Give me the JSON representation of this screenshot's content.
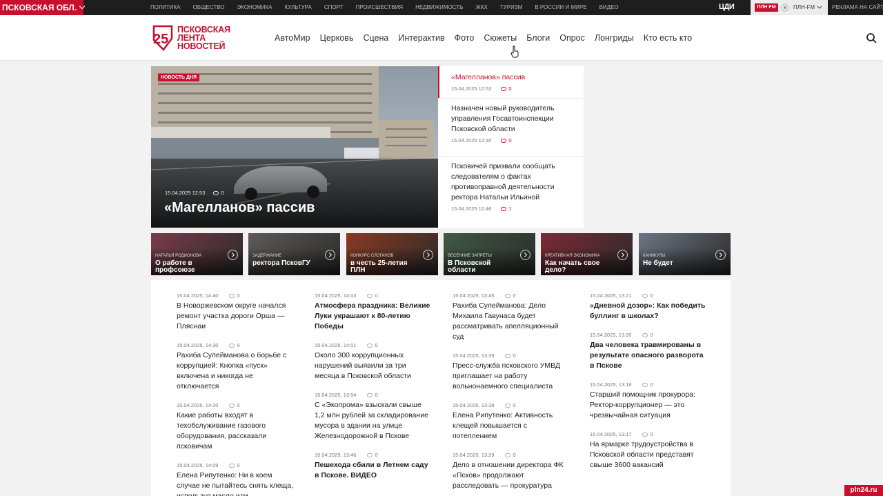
{
  "topbar": {
    "region": "ПСКОВСКАЯ ОБЛ.",
    "categories": [
      "ПОЛИТИКА",
      "ОБЩЕСТВО",
      "ЭКОНОМИКА",
      "КУЛЬТУРА",
      "СПОРТ",
      "ПРОИСШЕСТВИЯ",
      "НЕДВИЖИМОСТЬ",
      "ЖКХ",
      "ТУРИЗМ",
      "В РОССИИ И МИРЕ",
      "ВИДЕО"
    ],
    "cdi_logo": "ЦДИ",
    "radio_badge": "ПЛН FM",
    "radio_name": "ПЛН-FM",
    "advertising": "РЕКЛАМА НА САЙТЕ"
  },
  "header": {
    "logo_lines": [
      "ПСКОВСКАЯ",
      "ЛЕНТА",
      "НОВОСТЕЙ"
    ],
    "logo_number": "25",
    "nav": [
      "АвтоМир",
      "Церковь",
      "Сцена",
      "Интерактив",
      "Фото",
      "Сюжеты",
      "Блоги",
      "Опрос",
      "Лонгриды",
      "Кто есть кто"
    ]
  },
  "hero": {
    "badge": "НОВОСТЬ ДНЯ",
    "date": "15.04.2025 12:53",
    "comments": "0",
    "title": "«Магелланов» пассив"
  },
  "side": [
    {
      "title": "«Магелланов» пассив",
      "date": "15.04.2025 12:53",
      "comments": "0"
    },
    {
      "title": "Назначен новый руководитель управления Госавтоинспекции Псковской области",
      "date": "15.04.2025 12:30",
      "comments": "0"
    },
    {
      "title": "Псковичей призвали сообщать следователям о фактах противоправной деятельности ректора Натальи Ильиной",
      "date": "15.04.2025 12:46",
      "comments": "1"
    }
  ],
  "thumbs": [
    {
      "kicker": "НАТАЛЬЯ РОДИОНОВА",
      "title": "О работе в профсоюзе",
      "color": "#7a3b4a"
    },
    {
      "kicker": "ЗАДЕРЖАНИЕ",
      "title": "ректора ПсковГУ",
      "color": "#5d5a58"
    },
    {
      "kicker": "КОНКУРС СЛОГАНОВ",
      "title": "в честь 25-летия ПЛН",
      "color": "#8a3a22"
    },
    {
      "kicker": "ВЕСЕННИЕ ЗАПРЕТЫ",
      "title": "В Псковской области",
      "color": "#3f5a44"
    },
    {
      "kicker": "КРЕАТИВНАЯ ЭКОНОМИКА",
      "title": "Как начать свое дело?",
      "color": "#7b2a35"
    },
    {
      "kicker": "КАНИКУЛЫ",
      "title": "Не будет",
      "color": "#6b7583"
    }
  ],
  "news": [
    [
      {
        "date": "15.04.2025, 14:40",
        "comments": "0",
        "title": "В Новоржевском округе начался ремонт участка дороги Орша — Пляснаи",
        "bold": false
      },
      {
        "date": "15.04.2025, 14:30",
        "comments": "0",
        "title": "Рахиба Сулейманова о борьбе с коррупцией: Кнопка «пуск» включена и никогда не отключается",
        "bold": false
      },
      {
        "date": "15.04.2025, 14:20",
        "comments": "0",
        "title": "Какие работы входят в техобслуживание газового оборудования, рассказали псковичам",
        "bold": false
      },
      {
        "date": "15.04.2025, 14:09",
        "comments": "0",
        "title": "Елена Рипутенко: Ни в коем случае не пытайтесь снять клеща, используя масло или",
        "bold": false
      }
    ],
    [
      {
        "date": "15.04.2025, 14:03",
        "comments": "0",
        "title": "Атмосфера праздника: Великие Луки украшают к 80-летию Победы",
        "bold": true
      },
      {
        "date": "15.04.2025, 14:01",
        "comments": "0",
        "title": "Около 300 коррупционных нарушений выявили за три месяца в Псковской области",
        "bold": false
      },
      {
        "date": "15.04.2025, 13:54",
        "comments": "0",
        "title": "С «Экопрома» взыскали свыше 1,2 млн рублей за складирование мусора в здании на улице Железнодорожной в Пскове",
        "bold": false
      },
      {
        "date": "15.04.2025, 13:46",
        "comments": "0",
        "title": "Пешехода сбили в Летнем саду в Пскове. ВИДЕО",
        "bold": true
      }
    ],
    [
      {
        "date": "15.04.2025, 13:45",
        "comments": "0",
        "title": "Рахиба Сулейманова: Дело Михаила Гавунаса будет рассматривать апелляционный суд",
        "bold": false
      },
      {
        "date": "15.04.2025, 13:39",
        "comments": "0",
        "title": "Пресс-служба псковского УМВД приглашает на работу вольнонаемного специалиста",
        "bold": false
      },
      {
        "date": "15.04.2025, 13:38",
        "comments": "0",
        "title": "Елена Рипутенко: Активность клещей повышается с потеплением",
        "bold": false
      },
      {
        "date": "15.04.2025, 13:29",
        "comments": "0",
        "title": "Дело в отношении директора ФК «Псков» продолжают расследовать — прокуратура",
        "bold": false
      }
    ],
    [
      {
        "date": "15.04.2025, 13:21",
        "comments": "0",
        "title": "«Дневной дозор»: Как победить буллинг в школах?",
        "bold": true
      },
      {
        "date": "15.04.2025, 13:20",
        "comments": "0",
        "title": "Два человека травмированы в результате опасного разворота в Пскове",
        "bold": true
      },
      {
        "date": "15.04.2025, 13:18",
        "comments": "0",
        "title": "Старший помощник прокурора: Ректор-коррупционер — это чрезвычайная ситуация",
        "bold": false
      },
      {
        "date": "15.04.2025, 13:17",
        "comments": "0",
        "title": "На ярмарке трудоустройства в Псковской области представят свыше 3600 вакансий",
        "bold": false
      }
    ]
  ],
  "watermark": "pln24.ru",
  "colors": {
    "brand": "#c8102e",
    "topbar": "#1e1e1e",
    "background": "#f2f2f2"
  }
}
